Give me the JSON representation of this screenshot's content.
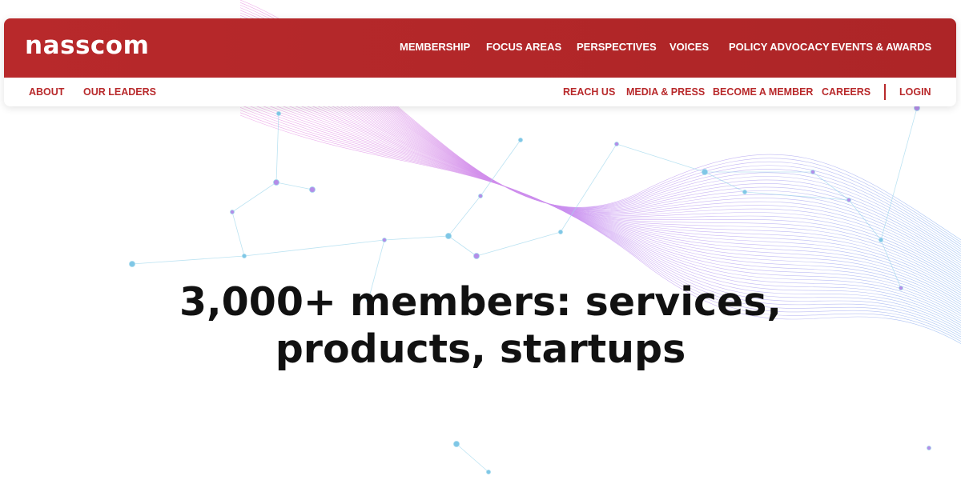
{
  "logo": {
    "text": "nasscom"
  },
  "main_nav": {
    "items": [
      "MEMBERSHIP",
      "FOCUS AREAS",
      "PERSPECTIVES",
      "VOICES",
      "POLICY ADVOCACY",
      "EVENTS & AWARDS"
    ]
  },
  "sub_nav": {
    "left": [
      "ABOUT",
      "OUR LEADERS"
    ],
    "right": [
      "REACH US",
      "MEDIA & PRESS",
      "BECOME A MEMBER",
      "CAREERS"
    ],
    "login": "LOGIN"
  },
  "hero": {
    "line1": "3,000+ members: services,",
    "line2": "products, startups"
  },
  "colors": {
    "brand_red": "#b8292b",
    "text_dark": "#111111"
  }
}
